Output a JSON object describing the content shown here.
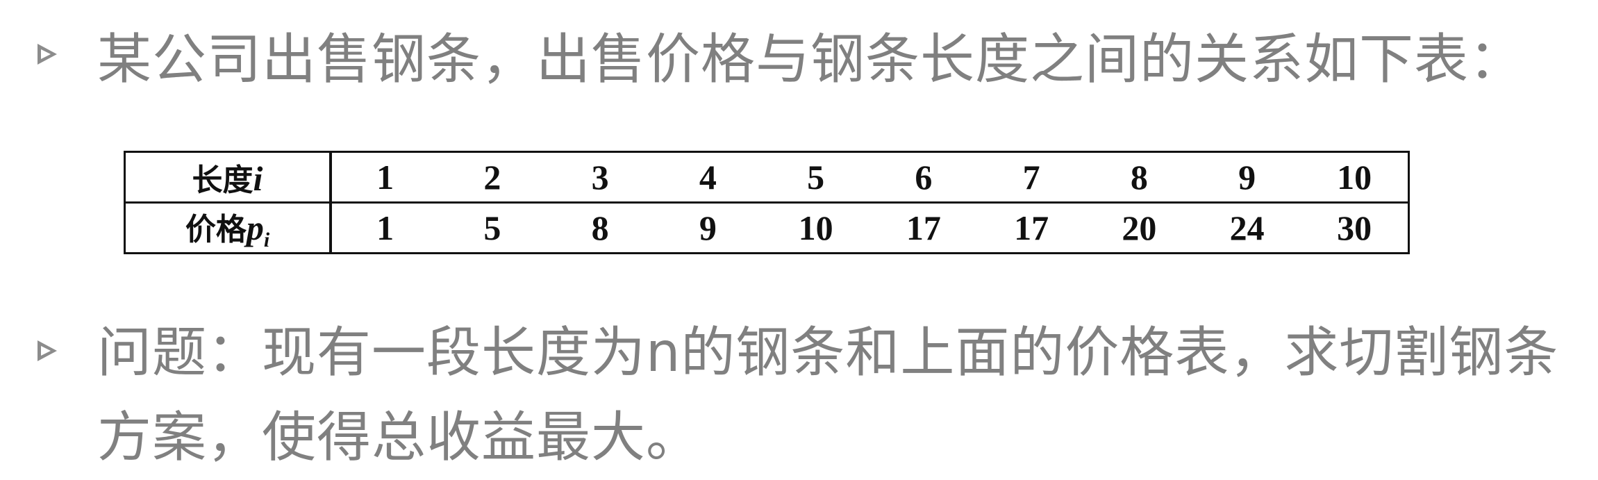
{
  "intro": {
    "text": "某公司出售钢条，出售价格与钢条长度之间的关系如下表："
  },
  "table": {
    "row_length": {
      "label": "长度",
      "var": "i",
      "values": [
        "1",
        "2",
        "3",
        "4",
        "5",
        "6",
        "7",
        "8",
        "9",
        "10"
      ]
    },
    "row_price": {
      "label": "价格",
      "var": "p",
      "sub": "i",
      "values": [
        "1",
        "5",
        "8",
        "9",
        "10",
        "17",
        "17",
        "20",
        "24",
        "30"
      ]
    }
  },
  "question": {
    "text": "问题：现有一段长度为n的钢条和上面的价格表，求切割钢条方案，使得总收益最大。"
  },
  "colors": {
    "text_gray": "#808080",
    "bullet_gray": "#8c8c8c",
    "table_black": "#111111"
  },
  "icons": {
    "bullet": "triangle-bullet-icon"
  }
}
